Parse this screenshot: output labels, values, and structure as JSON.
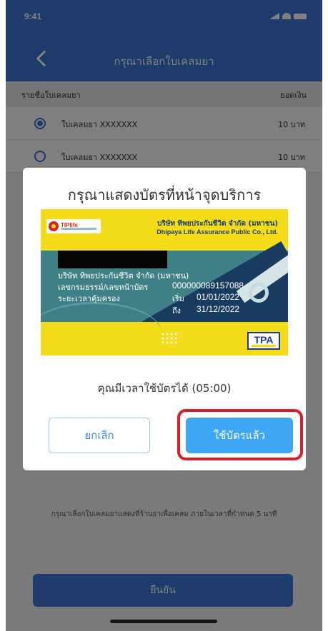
{
  "status_bar": {
    "time": "9:41"
  },
  "header": {
    "title": "กรุณาเลือกใบเคลมยา",
    "back_icon": "chevron-left-icon"
  },
  "list": {
    "header_left": "รายชื่อใบเคลมยา",
    "header_right": "ยอดเงิน",
    "rows": [
      {
        "name": "ใบเคลมยา XXXXXXX",
        "amount": "10 บาท",
        "selected": true
      },
      {
        "name": "ใบเคลมยา XXXXXXX",
        "amount": "10 บาท",
        "selected": false
      }
    ]
  },
  "footer": {
    "note": "กรุณาเลือกใบเคลมยาแสดงที่ร้านยาเพื่อเคลม ภายในเวลาที่กำหนด 5 นาที",
    "confirm_label": "ยืนยัน"
  },
  "modal": {
    "title": "กรุณาแสดงบัตรที่หน้าจุดบริการ",
    "card": {
      "logo_text": "TIPlife",
      "insurer_th": "บริษัท ทิพยประกันชีวิต จำกัด (มหาชน)",
      "insurer_en": "Dhipaya Life Assurance Public Co., Ltd.",
      "company_line": "บริษัท ทิพยประกันชีวิต จำกัด (มหาชน)",
      "policy_label": "เลขกรมธรรม์/เลขหน้าบัตร",
      "policy_number": "000000089157088",
      "coverage_label": "ระยะเวลาคุ้มครอง",
      "start_label": "เริ่ม",
      "start_date": "01/01/2022",
      "end_label": "ถึง",
      "end_date": "31/12/2022",
      "badge": "TPA",
      "colors": {
        "yellow": "#f4dc1b",
        "teal": "#3f7f86",
        "navy": "#173c5f"
      }
    },
    "timer_text": "คุณมีเวลาใช้บัตรได้ (05:00)",
    "cancel_label": "ยกเลิก",
    "used_label": "ใช้บัตรแล้ว"
  },
  "colors": {
    "primary": "#3b77d6",
    "accent": "#3ea7f5",
    "highlight": "#d7202a"
  }
}
